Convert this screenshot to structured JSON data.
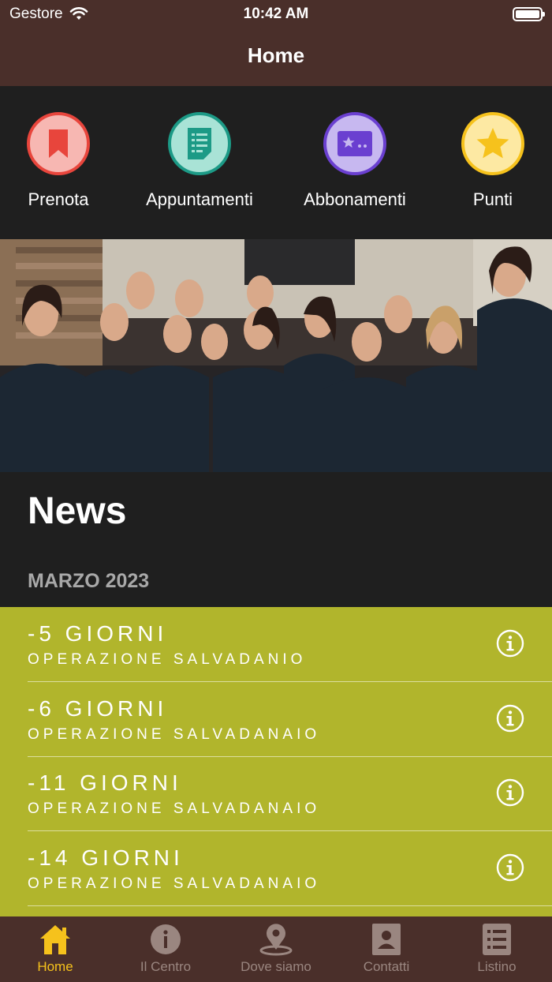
{
  "status_bar": {
    "carrier": "Gestore",
    "time": "10:42 AM"
  },
  "nav": {
    "title": "Home"
  },
  "quick_actions": [
    {
      "label": "Prenota",
      "icon": "bookmark-icon",
      "color": "#e8453c",
      "bg": "#f7b7b2"
    },
    {
      "label": "Appuntamenti",
      "icon": "document-list-icon",
      "color": "#1c9a86",
      "bg": "#a9e3d6"
    },
    {
      "label": "Abbonamenti",
      "icon": "ticket-card-icon",
      "color": "#6a3fd0",
      "bg": "#c7b8f0"
    },
    {
      "label": "Punti",
      "icon": "star-icon",
      "color": "#f6c21c",
      "bg": "#fde9a3"
    }
  ],
  "news": {
    "title": "News",
    "month": "MARZO 2023",
    "items": [
      {
        "title": "-5 GIORNI",
        "subtitle": "OPERAZIONE SALVADANIO"
      },
      {
        "title": "-6 GIORNI",
        "subtitle": "OPERAZIONE SALVADANAIO"
      },
      {
        "title": "-11 GIORNI",
        "subtitle": "OPERAZIONE SALVADANAIO"
      },
      {
        "title": "-14 GIORNI",
        "subtitle": "OPERAZIONE SALVADANAIO"
      }
    ]
  },
  "tabs": [
    {
      "label": "Home",
      "icon": "home-icon",
      "active": true
    },
    {
      "label": "Il Centro",
      "icon": "info-icon",
      "active": false
    },
    {
      "label": "Dove siamo",
      "icon": "location-pin-icon",
      "active": false
    },
    {
      "label": "Contatti",
      "icon": "contact-card-icon",
      "active": false
    },
    {
      "label": "Listino",
      "icon": "list-icon",
      "active": false
    }
  ],
  "colors": {
    "header": "#4a2f2a",
    "background": "#1f1f1f",
    "news_list": "#b1b52c",
    "tab_active": "#f6c21c",
    "tab_inactive": "#9a8680"
  }
}
